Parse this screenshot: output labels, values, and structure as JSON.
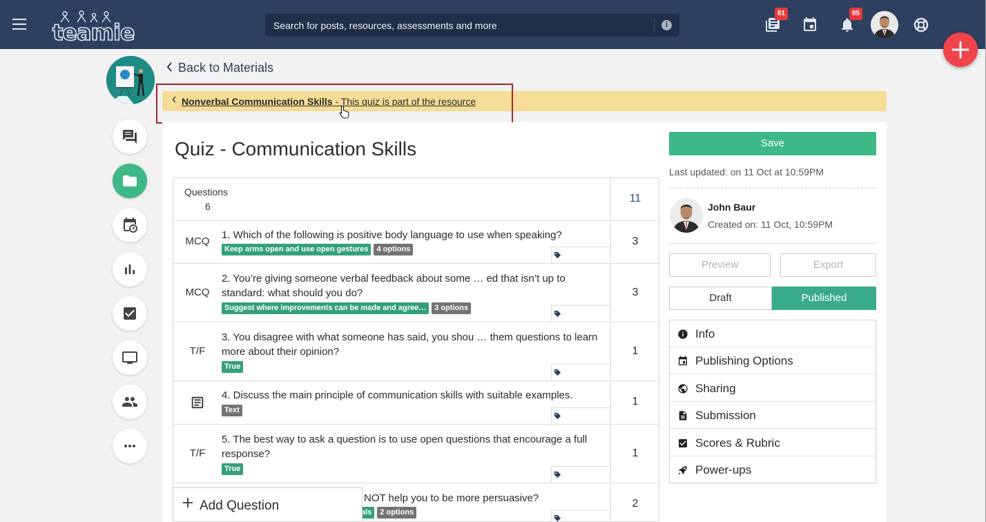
{
  "app": {
    "logo_text": "teamie",
    "accent": "#3db886",
    "topbar_color": "#2d4060"
  },
  "topbar": {
    "search_placeholder": "Search for posts, resources, assessments and more",
    "badges": {
      "posts": "61",
      "notifications": "85"
    }
  },
  "nav": {
    "back_label": "Back to Materials"
  },
  "banner": {
    "resource_name": "Nonverbal Communication Skills",
    "suffix": " - This quiz is part of the resource",
    "color": "#f6dd97"
  },
  "quiz": {
    "title": "Quiz - Communication Skills",
    "questions_label": "Questions",
    "questions_count": "6",
    "total_score": "11",
    "add_question_label": "Add Question",
    "rows": [
      {
        "type": "MCQ",
        "text": "1. Which of the following is positive body language to use when speaking?",
        "tags": [
          "Keep arms open and use open gestures",
          "4 options"
        ],
        "score": "3"
      },
      {
        "type": "MCQ",
        "text": "2. You’re giving someone verbal feedback about some … ed that isn’t up to standard: what should you do?",
        "tags": [
          "Suggest where improvements can be made and agree…",
          "3 options"
        ],
        "score": "3"
      },
      {
        "type": "T/F",
        "text": "3. You disagree with what someone has said, you shou … them questions to learn more about their opinion?",
        "tags": [
          "True"
        ],
        "score": "1"
      },
      {
        "type": "",
        "icon": "document-icon",
        "text": "4. Discuss the main principle of communication skills with suitable examples.",
        "tags": [
          "Text"
        ],
        "score": "1"
      },
      {
        "type": "T/F",
        "text": "5. The best way to ask a question is to use open questions that encourage a full response?",
        "tags": [
          "True"
        ],
        "score": "1"
      },
      {
        "type": "",
        "text": "NOT help you to be more persuasive?",
        "tags": [
          "als",
          "2 options"
        ],
        "score": "2"
      }
    ]
  },
  "sidebar": {
    "save_label": "Save",
    "last_updated": "Last updated: on 11 Oct at 10:59PM",
    "author_name": "John Baur",
    "created_on": "Created on: 11 Oct, 10:59PM",
    "preview_label": "Preview",
    "export_label": "Export",
    "draft_label": "Draft",
    "published_label": "Published",
    "menu": [
      {
        "label": "Info",
        "icon": "info-icon"
      },
      {
        "label": "Publishing Options",
        "icon": "calendar-icon"
      },
      {
        "label": "Sharing",
        "icon": "globe-icon"
      },
      {
        "label": "Submission",
        "icon": "file-icon"
      },
      {
        "label": "Scores & Rubric",
        "icon": "checkbox-icon"
      },
      {
        "label": "Power-ups",
        "icon": "rocket-icon"
      }
    ]
  },
  "left_rail": [
    "chat-icon",
    "folder-icon",
    "calendar-clock-icon",
    "bar-chart-icon",
    "checkbox-icon",
    "monitor-icon",
    "people-icon",
    "more-icon"
  ]
}
